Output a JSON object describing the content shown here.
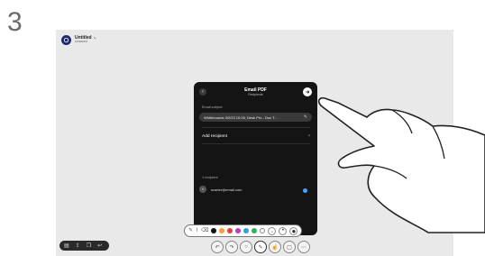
{
  "step_number": "3",
  "board": {
    "title": "Untitled",
    "title_edit_icon": "pencil-icon",
    "subtitle": "Unsaved"
  },
  "email_panel": {
    "title": "Email PDF",
    "subtitle": "Recipients",
    "subject_label": "Email subject",
    "subject_value": "Whiteboards 3/2/23 10:26, Desk Pro - Doc T...",
    "add_recipient_label": "Add recipient",
    "recipient_count": "1 recipient",
    "recipient_email": "scarter@email.com",
    "recipient_initials": "S"
  },
  "toolbar": {
    "colors": [
      "#111111",
      "#f0a030",
      "#e04040",
      "#b040c0",
      "#30a0e0",
      "#30b060",
      "#ffffff"
    ],
    "selected_color_index": 0
  },
  "colors": {
    "panel_bg": "#141414",
    "board_bg": "#e9e9e9",
    "accent_blue": "#4aa3ff"
  }
}
